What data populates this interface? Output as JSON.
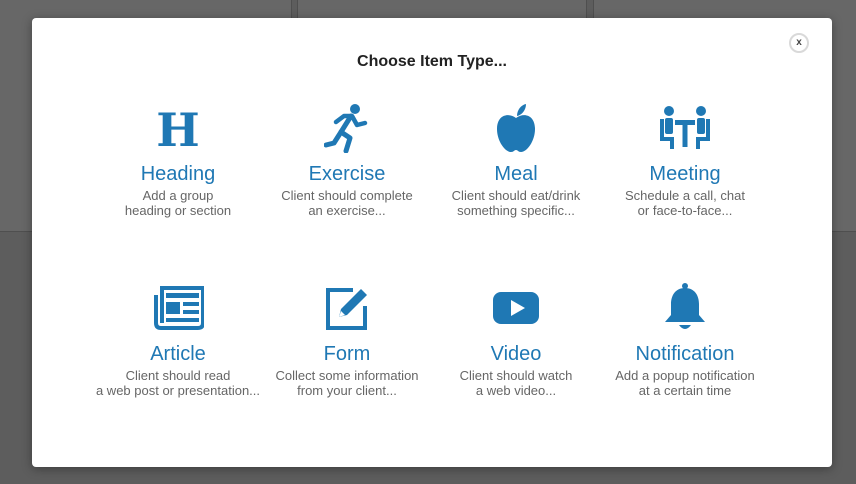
{
  "modal": {
    "title": "Choose Item Type...",
    "close_label": "x"
  },
  "accent_color": "#1f78b4",
  "items": [
    {
      "name": "Heading",
      "icon": "heading-icon",
      "desc_line1": "Add a group",
      "desc_line2": "heading or section"
    },
    {
      "name": "Exercise",
      "icon": "runner-icon",
      "desc_line1": "Client should complete",
      "desc_line2": "an exercise..."
    },
    {
      "name": "Meal",
      "icon": "apple-icon",
      "desc_line1": "Client should eat/drink",
      "desc_line2": "something specific..."
    },
    {
      "name": "Meeting",
      "icon": "meeting-icon",
      "desc_line1": "Schedule a call, chat",
      "desc_line2": "or face-to-face..."
    },
    {
      "name": "Article",
      "icon": "newspaper-icon",
      "desc_line1": "Client should read",
      "desc_line2": "a web post or presentation..."
    },
    {
      "name": "Form",
      "icon": "edit-icon",
      "desc_line1": "Collect some information",
      "desc_line2": "from your client..."
    },
    {
      "name": "Video",
      "icon": "video-play-icon",
      "desc_line1": "Client should watch",
      "desc_line2": "a web video..."
    },
    {
      "name": "Notification",
      "icon": "bell-icon",
      "desc_line1": "Add a popup notification",
      "desc_line2": "at a certain time"
    }
  ]
}
